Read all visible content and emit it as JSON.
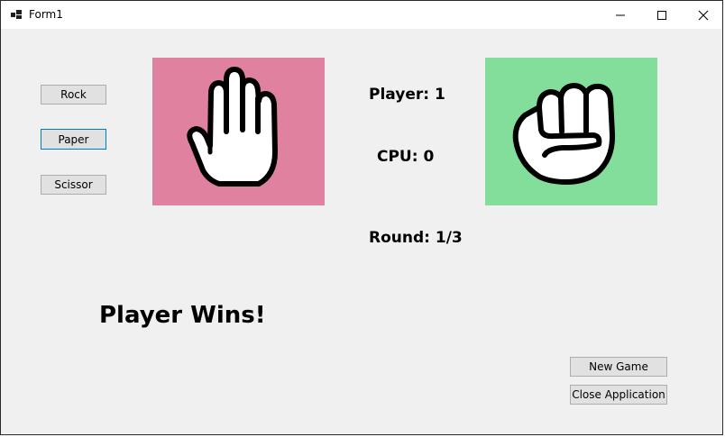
{
  "window": {
    "title": "Form1"
  },
  "choices": {
    "rock": "Rock",
    "paper": "Paper",
    "scissor": "Scissor"
  },
  "player_hand": {
    "icon": "paper-hand-icon",
    "bg_color": "#e0829f"
  },
  "cpu_hand": {
    "icon": "rock-fist-icon",
    "bg_color": "#82de9a"
  },
  "score": {
    "player": "Player: 1",
    "cpu": "CPU: 0",
    "round": "Round: 1/3"
  },
  "result": "Player Wins!",
  "actions": {
    "new_game": "New Game",
    "close_app": "Close Application"
  }
}
